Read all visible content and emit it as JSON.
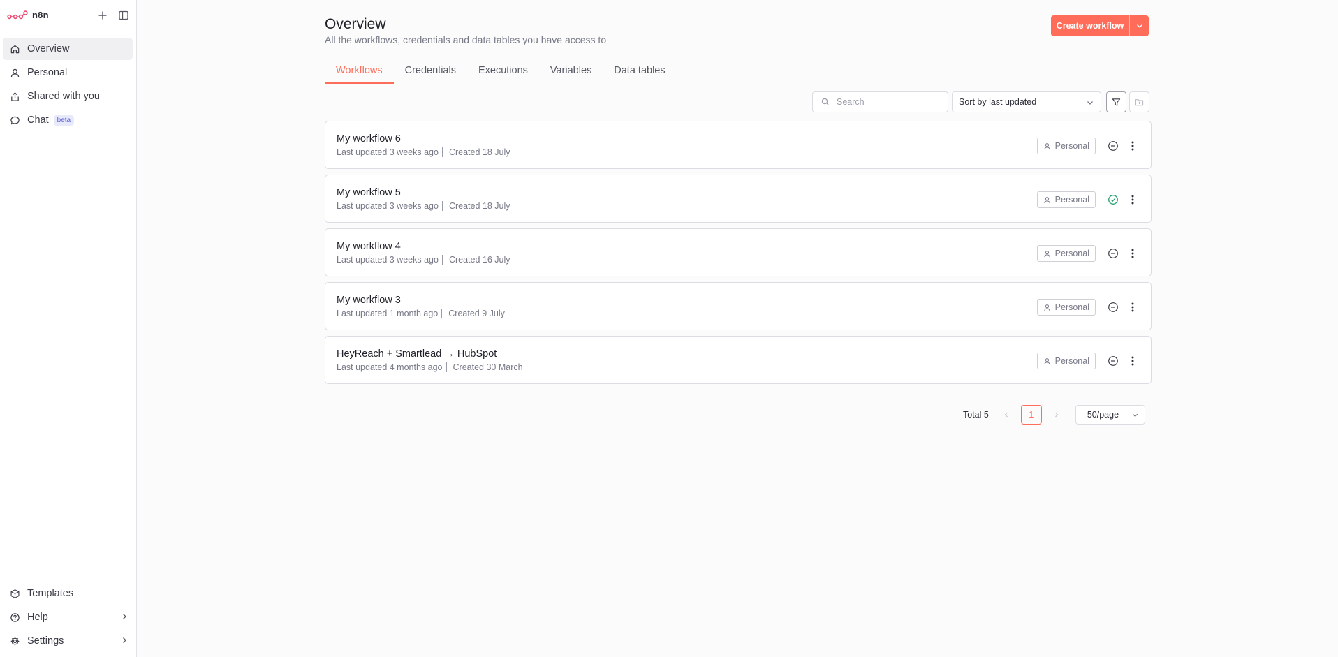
{
  "app": {
    "name": "n8n"
  },
  "sidebar": {
    "items": [
      {
        "label": "Overview",
        "icon": "home-icon",
        "active": true
      },
      {
        "label": "Personal",
        "icon": "user-icon"
      },
      {
        "label": "Shared with you",
        "icon": "share-icon"
      },
      {
        "label": "Chat",
        "icon": "chat-icon",
        "badge": "beta"
      }
    ],
    "bottom_items": [
      {
        "label": "Templates",
        "icon": "box-icon"
      },
      {
        "label": "Help",
        "icon": "help-icon"
      },
      {
        "label": "Settings",
        "icon": "gear-icon"
      }
    ]
  },
  "header": {
    "title": "Overview",
    "subtitle": "All the workflows, credentials and data tables you have access to",
    "create_label": "Create workflow"
  },
  "tabs": [
    {
      "label": "Workflows",
      "active": true
    },
    {
      "label": "Credentials"
    },
    {
      "label": "Executions"
    },
    {
      "label": "Variables"
    },
    {
      "label": "Data tables"
    }
  ],
  "toolbar": {
    "search_placeholder": "Search",
    "sort_label": "Sort by last updated"
  },
  "workflows": [
    {
      "name": "My workflow 6",
      "updated": "Last updated 3 weeks ago",
      "created": "Created 18 July",
      "owner": "Personal",
      "active": false
    },
    {
      "name": "My workflow 5",
      "updated": "Last updated 3 weeks ago",
      "created": "Created 18 July",
      "owner": "Personal",
      "active": true
    },
    {
      "name": "My workflow 4",
      "updated": "Last updated 3 weeks ago",
      "created": "Created 16 July",
      "owner": "Personal",
      "active": false
    },
    {
      "name": "My workflow 3",
      "updated": "Last updated 1 month ago",
      "created": "Created 9 July",
      "owner": "Personal",
      "active": false
    },
    {
      "name": "HeyReach + Smartlead → HubSpot",
      "updated": "Last updated 4 months ago",
      "created": "Created 30 March",
      "owner": "Personal",
      "active": false
    }
  ],
  "pagination": {
    "total": "Total 5",
    "current_page": "1",
    "page_size": "50/page"
  },
  "colors": {
    "accent": "#ff6d5a",
    "active_status": "#22a06b",
    "beta_badge": "#5b5ed6"
  }
}
